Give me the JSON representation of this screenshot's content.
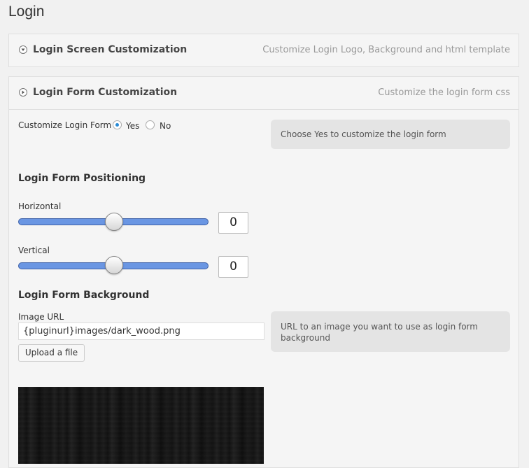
{
  "page": {
    "title": "Login"
  },
  "panels": [
    {
      "title": "Login Screen Customization",
      "description": "Customize Login Logo, Background and html template",
      "state": "collapsed"
    },
    {
      "title": "Login Form Customization",
      "description": "Customize the login form css",
      "state": "expanded"
    }
  ],
  "customize_form": {
    "label": "Customize Login Form",
    "options": [
      "Yes",
      "No"
    ],
    "selected": "Yes",
    "help": "Choose Yes to customize the login form"
  },
  "positioning": {
    "heading": "Login Form Positioning",
    "horizontal": {
      "label": "Horizontal",
      "value": "0"
    },
    "vertical": {
      "label": "Vertical",
      "value": "0"
    }
  },
  "background": {
    "heading": "Login Form Background",
    "image_url_label": "Image URL",
    "image_url_value": "{pluginurl}images/dark_wood.png",
    "upload_label": "Upload a file",
    "help": "URL to an image you want to use as login form background",
    "preview_image": "dark_wood.png"
  },
  "colors": {
    "slider_fill": "#6a96e3",
    "radio_selected": "#2a8bd6",
    "help_box_bg": "#e4e4e4"
  }
}
